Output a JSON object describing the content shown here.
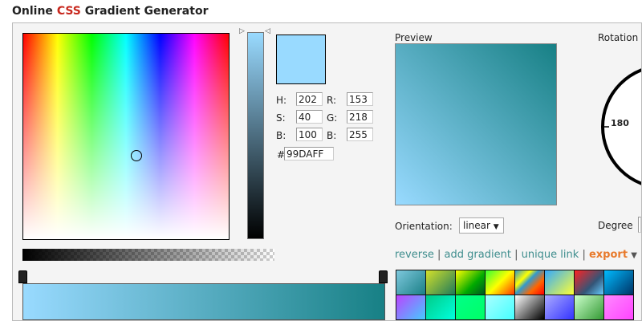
{
  "title": {
    "part1": "Online",
    "part2": "CSS",
    "part3": "Gradient Generator"
  },
  "color": {
    "h": "202",
    "s": "40",
    "b": "100",
    "r": "153",
    "g": "218",
    "bl": "255",
    "hex": "99DAFF",
    "hex_prefix": "#",
    "labels": {
      "h": "H:",
      "s": "S:",
      "b": "B:",
      "r": "R:",
      "g": "G:",
      "bl": "B:"
    }
  },
  "preview": {
    "label": "Preview"
  },
  "orientation": {
    "label": "Orientation:",
    "value": "linear"
  },
  "rotation": {
    "label": "Rotation",
    "tick": "180",
    "degree_label": "Degree"
  },
  "links": {
    "reverse": "reverse",
    "add": "add gradient",
    "unique": "unique link",
    "export": "export",
    "sep": "|"
  },
  "presets": [
    "linear-gradient(135deg,#7ec8dd,#1a7f86)",
    "linear-gradient(135deg,#d4e02a,#1e7a5a)",
    "linear-gradient(135deg,#ff0,#0a0 60%,#052)",
    "linear-gradient(135deg,#3f3,#ff0 50%,#f30)",
    "linear-gradient(135deg,#39c 0%,#ff0 30%,#39c 45%,#f60 70%,#f00)",
    "linear-gradient(135deg,#3af,#ff3)",
    "linear-gradient(135deg,#f22,#357 60%,#6cf)",
    "linear-gradient(135deg,#0bf,#036)",
    "linear-gradient(135deg,#b4f,#4cf)",
    "linear-gradient(135deg,#0c8,#0fd)",
    "linear-gradient(135deg,#0f8,#0f6)",
    "linear-gradient(135deg,#aff,#4ff)",
    "linear-gradient(135deg,#fff,#000)",
    "linear-gradient(135deg,#aaf,#33f)",
    "linear-gradient(135deg,#cfc,#393)",
    "linear-gradient(135deg,#f8f,#f4f)"
  ]
}
